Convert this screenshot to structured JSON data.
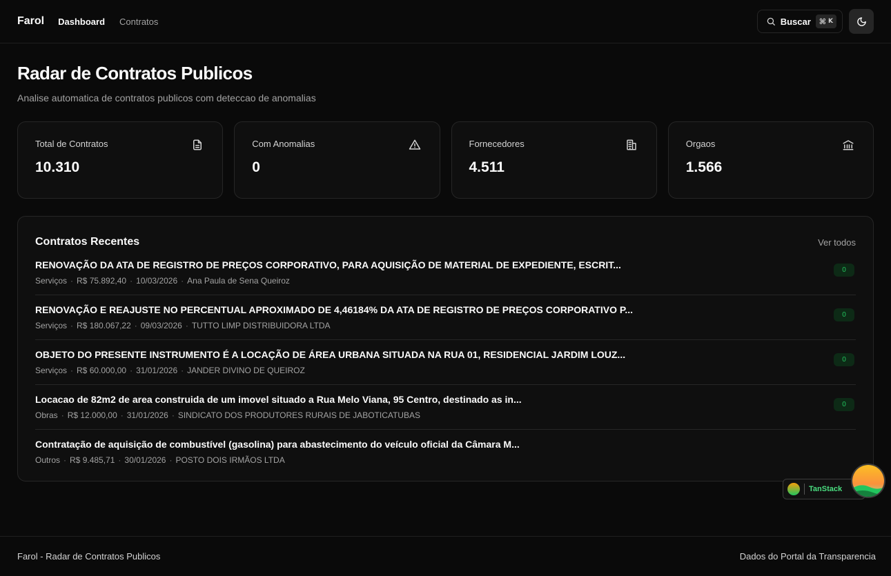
{
  "header": {
    "brand": "Farol",
    "nav": [
      {
        "label": "Dashboard",
        "active": true
      },
      {
        "label": "Contratos",
        "active": false
      }
    ],
    "search_label": "Buscar",
    "search_shortcut_mod": "⌘",
    "search_shortcut_key": "K",
    "theme_icon": "moon-icon"
  },
  "main": {
    "title": "Radar de Contratos Publicos",
    "subtitle": "Analise automatica de contratos publicos com deteccao de anomalias"
  },
  "stats": [
    {
      "label": "Total de Contratos",
      "value": "10.310",
      "icon": "document-icon"
    },
    {
      "label": "Com Anomalias",
      "value": "0",
      "icon": "warning-triangle-icon"
    },
    {
      "label": "Fornecedores",
      "value": "4.511",
      "icon": "building-icon"
    },
    {
      "label": "Orgaos",
      "value": "1.566",
      "icon": "landmark-icon"
    }
  ],
  "recent": {
    "title": "Contratos Recentes",
    "see_all": "Ver todos",
    "items": [
      {
        "title": "RENOVAÇÃO DA ATA DE REGISTRO DE PREÇOS CORPORATIVO, PARA AQUISIÇÃO DE MATERIAL DE EXPEDIENTE, ESCRIT...",
        "category": "Serviços",
        "value": "R$ 75.892,40",
        "date": "10/03/2026",
        "supplier": "Ana Paula de Sena Queiroz",
        "score": "0"
      },
      {
        "title": "RENOVAÇÃO E REAJUSTE NO PERCENTUAL APROXIMADO DE 4,46184% DA ATA DE REGISTRO DE PREÇOS CORPORATIVO P...",
        "category": "Serviços",
        "value": "R$ 180.067,22",
        "date": "09/03/2026",
        "supplier": "TUTTO LIMP DISTRIBUIDORA LTDA",
        "score": "0"
      },
      {
        "title": "OBJETO DO PRESENTE INSTRUMENTO É A LOCAÇÃO DE ÁREA URBANA SITUADA NA RUA 01, RESIDENCIAL JARDIM LOUZ...",
        "category": "Serviços",
        "value": "R$ 60.000,00",
        "date": "31/01/2026",
        "supplier": "JANDER DIVINO DE QUEIROZ",
        "score": "0"
      },
      {
        "title": "Locacao de 82m2 de area construida de um imovel situado a Rua Melo Viana, 95 Centro, destinado as in...",
        "category": "Obras",
        "value": "R$ 12.000,00",
        "date": "31/01/2026",
        "supplier": "SINDICATO DOS PRODUTORES RURAIS DE JABOTICATUBAS",
        "score": "0"
      },
      {
        "title": "Contratação de aquisição de combustível (gasolina) para abastecimento do veículo oficial da Câmara M...",
        "category": "Outros",
        "value": "R$ 9.485,71",
        "date": "30/01/2026",
        "supplier": "POSTO DOIS IRMÃOS LTDA",
        "score": ""
      }
    ]
  },
  "footer": {
    "left": "Farol - Radar de Contratos Publicos",
    "right": "Dados do Portal da Transparencia"
  },
  "devtools": {
    "label": "TanStack"
  },
  "colors": {
    "background": "#0a0a0a",
    "card": "#0f0f0f",
    "border": "#262626",
    "badge_bg": "#0d2a16",
    "badge_fg": "#22c55e",
    "devtools_accent": "#4ade80"
  }
}
